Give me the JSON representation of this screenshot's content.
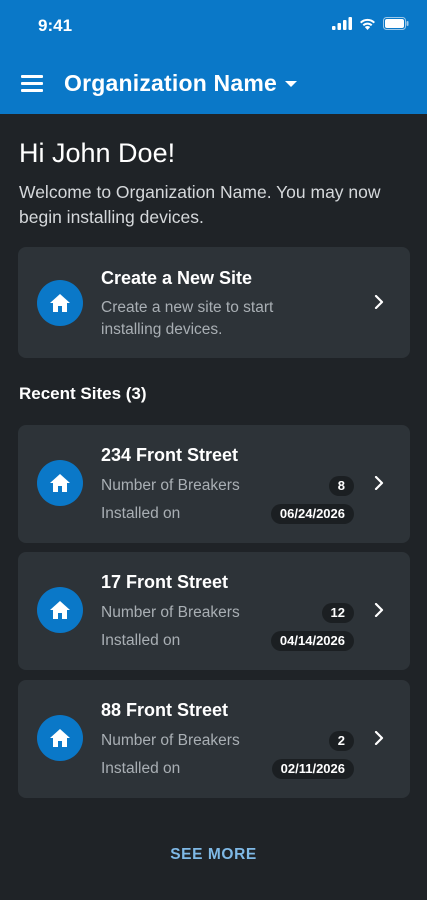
{
  "status_bar": {
    "time": "9:41"
  },
  "header": {
    "org_name": "Organization Name"
  },
  "greeting": "Hi John Doe!",
  "welcome": "Welcome to Organization Name. You may now begin installing devices.",
  "create_site": {
    "title": "Create a New Site",
    "subtitle": "Create a new site to start installing devices."
  },
  "recent": {
    "title": "Recent Sites (3)",
    "sites": [
      {
        "name": "234 Front Street",
        "breakers_label": "Number of Breakers",
        "breakers": "8",
        "installed_label": "Installed on",
        "date": "06/24/2026"
      },
      {
        "name": "17 Front Street",
        "breakers_label": "Number of Breakers",
        "breakers": "12",
        "installed_label": "Installed on",
        "date": "04/14/2026"
      },
      {
        "name": "88 Front Street",
        "breakers_label": "Number of Breakers",
        "breakers": "2",
        "installed_label": "Installed on",
        "date": "02/11/2026"
      }
    ]
  },
  "see_more": "SEE MORE",
  "colors": {
    "primary": "#0a78c8",
    "background": "#1f2327",
    "card": "#2d3338",
    "link": "#7fb9e6"
  }
}
